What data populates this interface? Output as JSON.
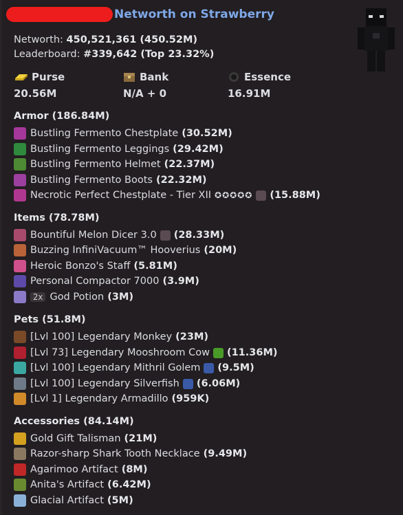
{
  "header": {
    "title": "Networth on Strawberry"
  },
  "summary": {
    "networth_label": "Networth:",
    "networth_value": "450,521,361 (450.52M)",
    "leaderboard_label": "Leaderboard:",
    "leaderboard_value": "#339,642 (Top 23.32%)"
  },
  "stats": {
    "purse": {
      "label": "Purse",
      "value": "20.56M"
    },
    "bank": {
      "label": "Bank",
      "value": "N/A + 0"
    },
    "essence": {
      "label": "Essence",
      "value": "16.91M"
    }
  },
  "sections": {
    "armor": {
      "title": "Armor (186.84M)",
      "items": [
        {
          "name": "Bustling Fermento Chestplate",
          "value": "(30.52M)",
          "icon": "chestplate-icon",
          "color": "#a6379a"
        },
        {
          "name": "Bustling Fermento Leggings",
          "value": "(29.42M)",
          "icon": "leggings-icon",
          "color": "#2f8a3e"
        },
        {
          "name": "Bustling Fermento Helmet",
          "value": "(22.37M)",
          "icon": "helmet-icon",
          "color": "#4d8a33"
        },
        {
          "name": "Bustling Fermento Boots",
          "value": "(22.32M)",
          "icon": "boots-icon",
          "color": "#9c3fa0"
        },
        {
          "name": "Necrotic Perfect Chestplate - Tier XII",
          "stars": "✪✪✪✪✪",
          "value": "(15.88M)",
          "icon": "perfect-chestplate-icon",
          "color": "#b0378f"
        }
      ]
    },
    "items": {
      "title": "Items (78.78M)",
      "items": [
        {
          "name": "Bountiful Melon Dicer 3.0",
          "value": "(28.33M)",
          "icon": "melon-dicer-icon",
          "color": "#a84a6b"
        },
        {
          "name": "Buzzing InfiniVacuum™ Hooverius",
          "value": "(20M)",
          "icon": "vacuum-icon",
          "color": "#b86438"
        },
        {
          "name": "Heroic Bonzo's Staff",
          "value": "(5.81M)",
          "icon": "staff-icon",
          "color": "#d0508c"
        },
        {
          "name": "Personal Compactor 7000",
          "value": "(3.9M)",
          "icon": "compactor-icon",
          "color": "#5c4aa8"
        },
        {
          "name": "God Potion",
          "badge": "2x",
          "value": "(3M)",
          "icon": "potion-icon",
          "color": "#8a7ac8"
        }
      ]
    },
    "pets": {
      "title": "Pets (51.8M)",
      "items": [
        {
          "name": "[Lvl 100] Legendary Monkey",
          "value": "(23M)",
          "icon": "monkey-icon",
          "color": "#7a4a28"
        },
        {
          "name": "[Lvl 73] Legendary Mooshroom Cow",
          "value": "(11.36M)",
          "icon": "mooshroom-icon",
          "color": "#b02030"
        },
        {
          "name": "[Lvl 100] Legendary Mithril Golem",
          "value": "(9.5M)",
          "icon": "golem-icon",
          "color": "#3aa8a0"
        },
        {
          "name": "[Lvl 100] Legendary Silverfish",
          "value": "(6.06M)",
          "icon": "silverfish-icon",
          "color": "#6e7a88"
        },
        {
          "name": "[Lvl 1] Legendary Armadillo",
          "value": "(959K)",
          "icon": "armadillo-icon",
          "color": "#d08a2a"
        }
      ]
    },
    "accessories": {
      "title": "Accessories (84.14M)",
      "items": [
        {
          "name": "Gold Gift Talisman",
          "value": "(21M)",
          "icon": "gift-icon",
          "color": "#d4a020"
        },
        {
          "name": "Razor-sharp Shark Tooth Necklace",
          "value": "(9.49M)",
          "icon": "necklace-icon",
          "color": "#8a7860"
        },
        {
          "name": "Agarimoo Artifact",
          "value": "(8M)",
          "icon": "agarimoo-icon",
          "color": "#c02828"
        },
        {
          "name": "Anita's Artifact",
          "value": "(6.42M)",
          "icon": "anita-icon",
          "color": "#6a8a30"
        },
        {
          "name": "Glacial Artifact",
          "value": "(5M)",
          "icon": "glacial-icon",
          "color": "#8ab0d8"
        }
      ]
    }
  },
  "colors": {
    "accent": "#7fa8e8",
    "redaction": "#ee1d1d",
    "background": "#221e21"
  }
}
